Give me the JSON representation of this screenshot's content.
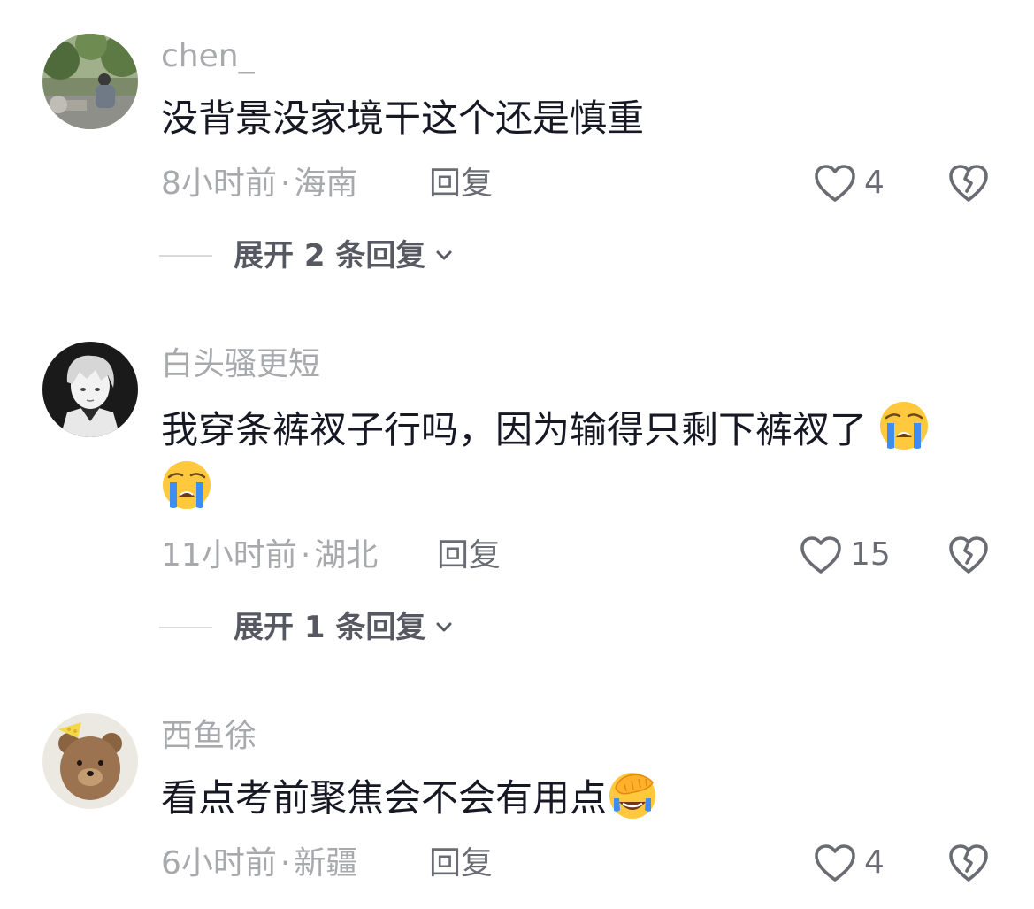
{
  "comments": [
    {
      "username": "chen_",
      "text": "没背景没家境干这个还是慎重",
      "time": "8小时前",
      "location": "海南",
      "reply_label": "回复",
      "likes": "4",
      "expand_label": "展开 2 条回复",
      "avatar_icon": "avatar-photo-person-sitting"
    },
    {
      "username": "白头骚更短",
      "text": "我穿条裤衩子行吗，因为输得只剩下裤衩了",
      "emojis": [
        "crying-face-emoji",
        "crying-face-emoji"
      ],
      "time": "11小时前",
      "location": "湖北",
      "reply_label": "回复",
      "likes": "15",
      "expand_label": "展开 1 条回复",
      "avatar_icon": "avatar-anime-boy"
    },
    {
      "username": "西鱼徐",
      "text": "看点考前聚焦会不会有用点",
      "emojis": [
        "facepalm-laugh-emoji"
      ],
      "time": "6小时前",
      "location": "新疆",
      "reply_label": "回复",
      "likes": "4",
      "avatar_icon": "avatar-teddy-bear"
    }
  ],
  "separator": "·",
  "colors": {
    "username": "#a8a9ad",
    "text": "#161823",
    "meta": "#a8a9ad",
    "action": "#6b6c73",
    "expand": "#575861",
    "emoji_yellow": "#ffc83d",
    "emoji_tear": "#3d8ef0"
  }
}
